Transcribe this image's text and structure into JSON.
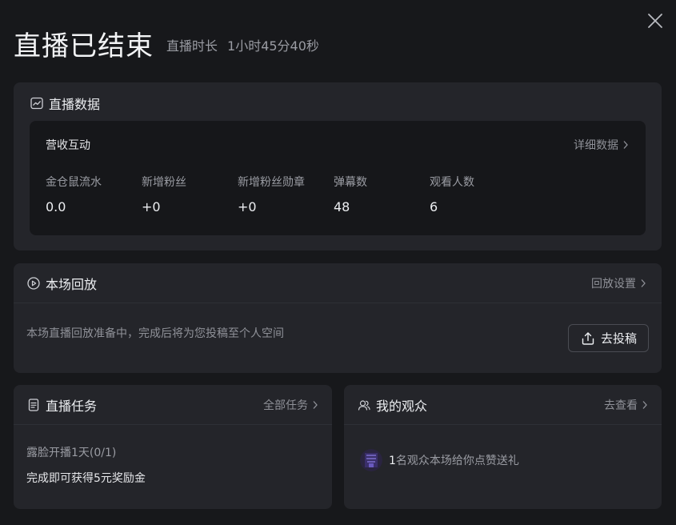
{
  "header": {
    "title": "直播已结束",
    "duration_label": "直播时长",
    "duration_value": "1小时45分40秒"
  },
  "data_section": {
    "title": "直播数据",
    "inner_title": "营收互动",
    "detail_link": "详细数据",
    "stats": [
      {
        "label": "金仓鼠流水",
        "value": "0.0"
      },
      {
        "label": "新增粉丝",
        "value": "+0"
      },
      {
        "label": "新增粉丝勋章",
        "value": "+0"
      },
      {
        "label": "弹幕数",
        "value": "48"
      },
      {
        "label": "观看人数",
        "value": "6"
      }
    ]
  },
  "replay_section": {
    "title": "本场回放",
    "settings_link": "回放设置",
    "message": "本场直播回放准备中，完成后将为您投稿至个人空间",
    "post_button": "去投稿"
  },
  "task_section": {
    "title": "直播任务",
    "all_link": "全部任务",
    "task_name": "露脸开播1天(0/1)",
    "task_desc": "完成即可获得5元奖励金"
  },
  "audience_section": {
    "title": "我的观众",
    "view_link": "去查看",
    "count": "1",
    "message": "名观众本场给你点赞送礼"
  },
  "icons": {
    "close": "close-icon",
    "chart": "chart-icon",
    "replay": "replay-icon",
    "upload": "upload-icon",
    "task": "document-icon",
    "audience": "people-icon",
    "chevron": "chevron-right-icon"
  }
}
